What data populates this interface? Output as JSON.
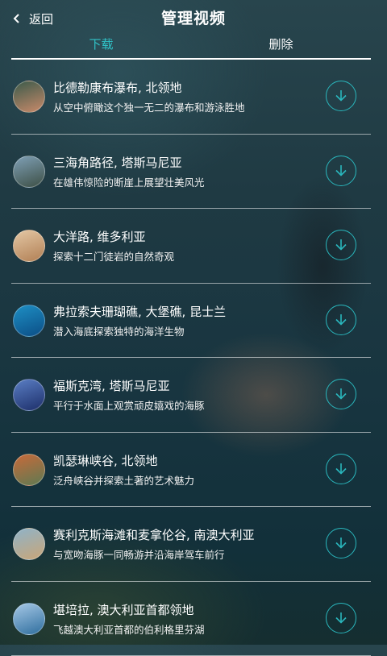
{
  "header": {
    "back_label": "返回",
    "title": "管理视频"
  },
  "tabs": [
    {
      "label": "下载",
      "active": true
    },
    {
      "label": "删除",
      "active": false
    }
  ],
  "colors": {
    "accent": "#30c3c8",
    "text": "#ffffff"
  },
  "videos": [
    {
      "name": "比德勒康布瀑布, 北领地",
      "desc": "从空中俯瞰这个独一无二的瀑布和游泳胜地",
      "thumb": [
        "#3b5a4a",
        "#c98a6a"
      ],
      "icon": "download-icon"
    },
    {
      "name": "三海角路径, 塔斯马尼亚",
      "desc": "在雄伟惊险的断崖上展望壮美风光",
      "thumb": [
        "#7fa0b6",
        "#3d4f45"
      ],
      "icon": "download-icon"
    },
    {
      "name": "大洋路, 维多利亚",
      "desc": "探索十二门徒岩的自然奇观",
      "thumb": [
        "#e3c7a4",
        "#b28055"
      ],
      "icon": "download-icon"
    },
    {
      "name": "弗拉索夫珊瑚礁, 大堡礁, 昆士兰",
      "desc": "潜入海底探索独特的海洋生物",
      "thumb": [
        "#1e8fc4",
        "#0b4e86"
      ],
      "icon": "download-icon"
    },
    {
      "name": "福斯克湾, 塔斯马尼亚",
      "desc": "平行于水面上观赏顽皮嬉戏的海豚",
      "thumb": [
        "#5a7ec4",
        "#1d2f6a"
      ],
      "icon": "download-icon"
    },
    {
      "name": "凯瑟琳峡谷, 北领地",
      "desc": "泛舟峡谷并探索土著的艺术魅力",
      "thumb": [
        "#c86a3a",
        "#5e7a52"
      ],
      "icon": "download-icon"
    },
    {
      "name": "赛利克斯海滩和麦拿伦谷, 南澳大利亚",
      "desc": "与宽吻海豚一同畅游并沿海岸驾车前行",
      "thumb": [
        "#8fb3c8",
        "#c9a678"
      ],
      "icon": "download-icon"
    },
    {
      "name": "堪培拉, 澳大利亚首都领地",
      "desc": "飞越澳大利亚首都的伯利格里芬湖",
      "thumb": [
        "#a6c8e6",
        "#2f6e9e"
      ],
      "icon": "download-icon"
    }
  ]
}
